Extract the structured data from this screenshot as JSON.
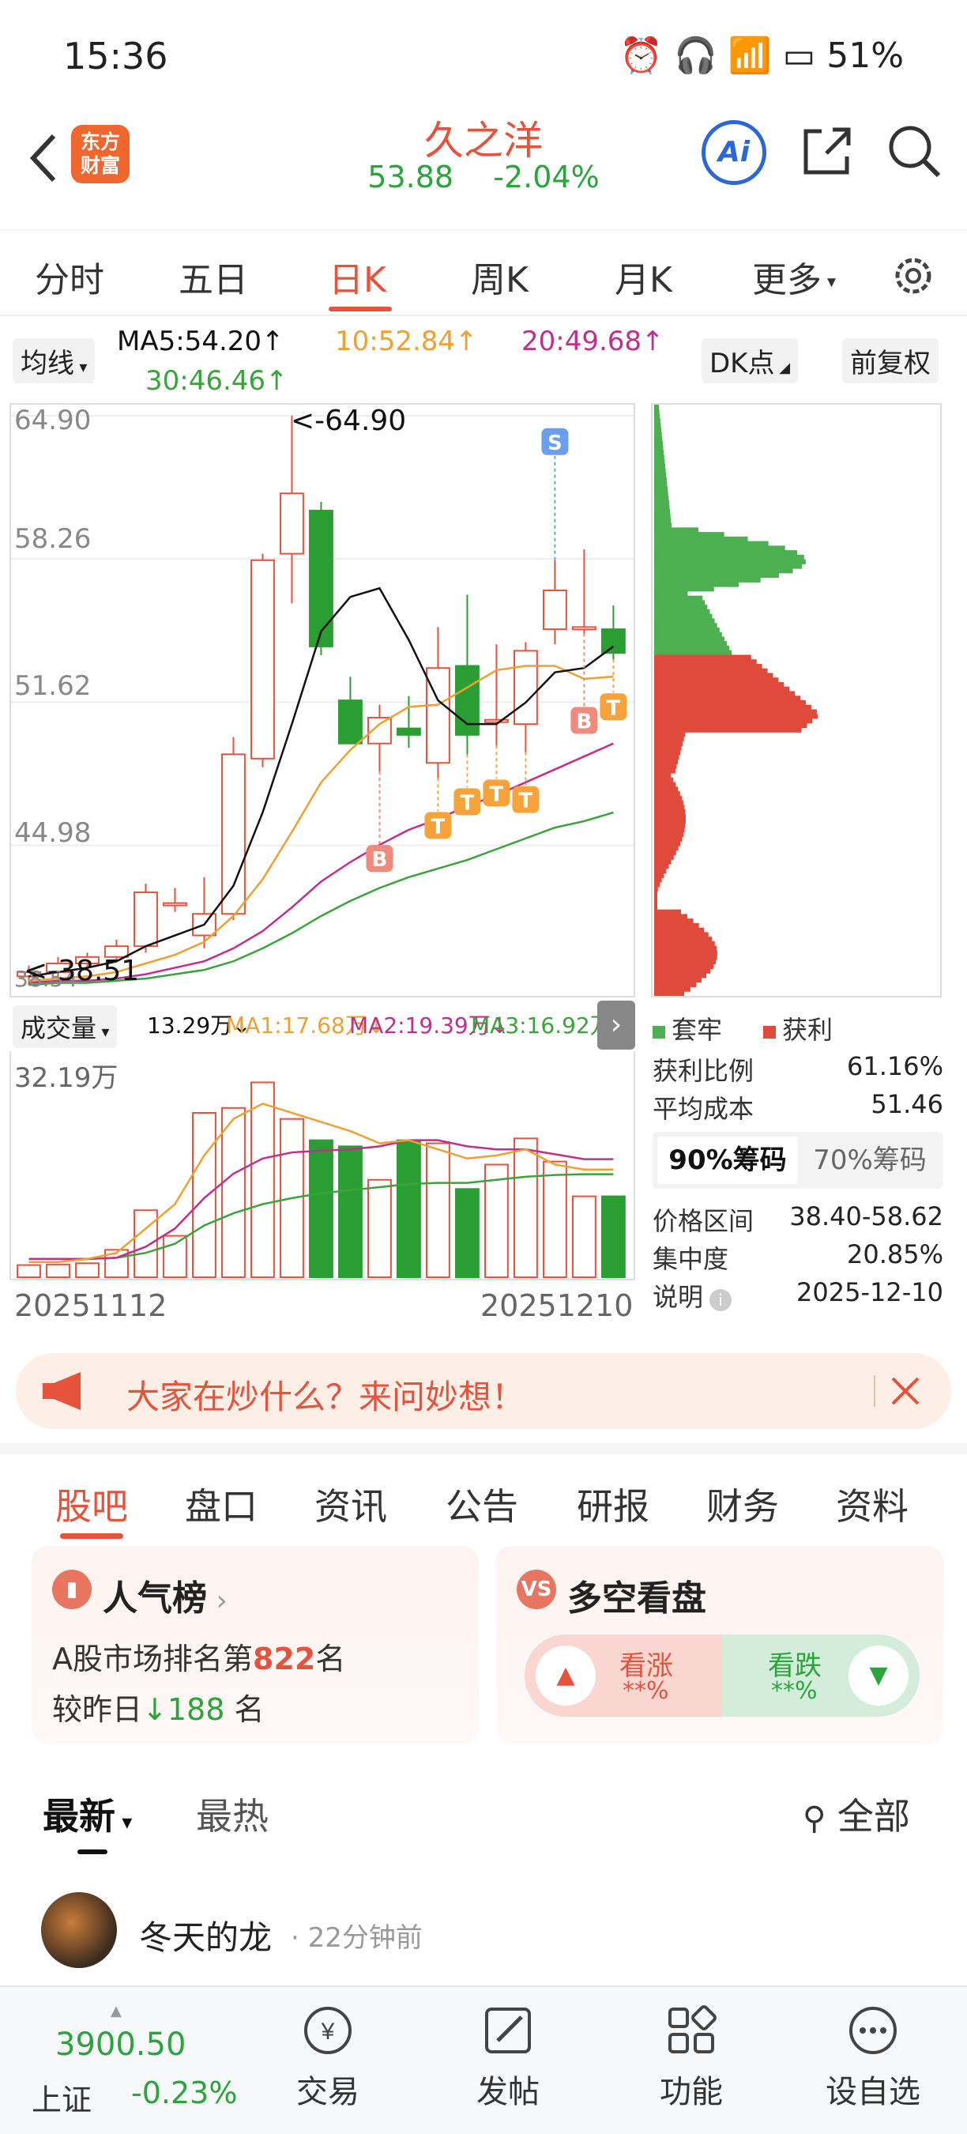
{
  "status_bar": {
    "time": "15:36",
    "battery": "51%"
  },
  "header": {
    "logo_text": "东方财富",
    "stock_name": "久之洋",
    "price": "53.88",
    "change": "-2.04%",
    "ai_label": "Ai"
  },
  "period_tabs": [
    "分时",
    "五日",
    "日K",
    "周K",
    "月K",
    "更多"
  ],
  "ma_bar": {
    "selector": "均线",
    "ma5": "MA5:54.20↑",
    "ma10": "10:52.84↑",
    "ma20": "20:49.68↑",
    "ma30": "30:46.46↑",
    "dk_button": "DK点",
    "fq_button": "前复权"
  },
  "kline_axis": {
    "y_ticks": [
      "64.90",
      "58.26",
      "51.62",
      "44.98"
    ],
    "bottom_tick": "38.54",
    "high_marker": "<-64.90",
    "low_marker": "<-38.51"
  },
  "volume_bar": {
    "selector": "成交量",
    "current": "13.29万↓",
    "ma1": "MA1:17.68万↓",
    "ma2": "MA2:19.39万↓",
    "ma3": "MA3:16.92万↑",
    "max_label": "32.19万",
    "date_start": "20251112",
    "date_end": "20251210"
  },
  "chip_panel": {
    "legend_trapped": "套牢",
    "legend_profit": "获利",
    "rows": [
      {
        "label": "获利比例",
        "value": "61.16%"
      },
      {
        "label": "平均成本",
        "value": "51.46"
      }
    ],
    "tab_90": "90%筹码",
    "tab_70": "70%筹码",
    "rows2": [
      {
        "label": "价格区间",
        "value": "38.40-58.62"
      },
      {
        "label": "集中度",
        "value": "20.85%"
      },
      {
        "label": "说明",
        "value": "2025-12-10"
      }
    ]
  },
  "banner": {
    "text": "大家在炒什么？来问妙想！"
  },
  "content_tabs": [
    "股吧",
    "盘口",
    "资讯",
    "公告",
    "研报",
    "财务",
    "资料"
  ],
  "popularity_card": {
    "title": "人气榜",
    "rank_prefix": "A股市场排名第",
    "rank": "822",
    "rank_suffix": "名",
    "change_prefix": "较昨日",
    "change_value": "188",
    "change_suffix": "名"
  },
  "sentiment_card": {
    "title": "多空看盘",
    "up_label": "看涨",
    "up_value": "**%",
    "down_label": "看跌",
    "down_value": "**%"
  },
  "feed": {
    "tab_latest": "最新",
    "tab_hot": "最热",
    "filter": "全部",
    "post_user": "冬天的龙",
    "post_time": "22分钟前"
  },
  "bottom_bar": {
    "index_value": "3900.50",
    "index_name": "上证",
    "index_change": "-0.23%",
    "items": [
      "交易",
      "发帖",
      "功能",
      "设自选"
    ]
  },
  "colors": {
    "up": "#e5533d",
    "down": "#2aa53b",
    "ma5": "#111111",
    "ma10": "#f0a030",
    "ma20": "#c0308a",
    "ma30": "#3aa33a"
  },
  "chart_data": {
    "type": "candlestick",
    "x_range": [
      "20251112",
      "20251210"
    ],
    "ylim": [
      38.51,
      64.9
    ],
    "candles": [
      {
        "o": 38.9,
        "h": 39.4,
        "l": 38.5,
        "c": 39.1
      },
      {
        "o": 39.1,
        "h": 39.8,
        "l": 38.9,
        "c": 39.5
      },
      {
        "o": 39.5,
        "h": 40.0,
        "l": 39.2,
        "c": 39.8
      },
      {
        "o": 39.8,
        "h": 40.6,
        "l": 39.6,
        "c": 40.3
      },
      {
        "o": 40.3,
        "h": 43.2,
        "l": 40.0,
        "c": 42.8
      },
      {
        "o": 42.3,
        "h": 43.0,
        "l": 41.9,
        "c": 42.3
      },
      {
        "o": 40.8,
        "h": 43.5,
        "l": 40.2,
        "c": 41.8
      },
      {
        "o": 41.8,
        "h": 50.0,
        "l": 41.5,
        "c": 49.2
      },
      {
        "o": 49.0,
        "h": 58.5,
        "l": 48.6,
        "c": 58.2
      },
      {
        "o": 58.5,
        "h": 64.9,
        "l": 56.2,
        "c": 61.3
      },
      {
        "o": 60.5,
        "h": 60.9,
        "l": 53.8,
        "c": 54.2
      },
      {
        "o": 51.7,
        "h": 52.8,
        "l": 49.7,
        "c": 49.7
      },
      {
        "o": 49.7,
        "h": 51.5,
        "l": 48.4,
        "c": 50.9
      },
      {
        "o": 50.4,
        "h": 51.9,
        "l": 49.5,
        "c": 50.1
      },
      {
        "o": 48.8,
        "h": 55.1,
        "l": 48.1,
        "c": 53.2
      },
      {
        "o": 53.3,
        "h": 56.6,
        "l": 49.2,
        "c": 50.1
      },
      {
        "o": 50.8,
        "h": 54.3,
        "l": 49.6,
        "c": 50.8
      },
      {
        "o": 50.6,
        "h": 54.4,
        "l": 49.3,
        "c": 54.0
      },
      {
        "o": 55.0,
        "h": 58.2,
        "l": 54.3,
        "c": 56.8
      },
      {
        "o": 55.0,
        "h": 58.7,
        "l": 54.8,
        "c": 55.1
      },
      {
        "o": 55.0,
        "h": 56.1,
        "l": 53.6,
        "c": 53.9
      }
    ],
    "ma5": [
      38.9,
      39.1,
      39.3,
      39.6,
      40.3,
      40.8,
      41.3,
      43.1,
      46.5,
      50.6,
      54.9,
      56.5,
      56.9,
      54.5,
      51.7,
      50.6,
      50.6,
      51.6,
      53.0,
      53.2,
      54.2
    ],
    "ma10": [
      38.7,
      38.8,
      38.9,
      39.1,
      39.5,
      39.9,
      40.5,
      41.7,
      43.4,
      45.6,
      47.9,
      49.4,
      50.6,
      51.4,
      51.5,
      52.3,
      53.1,
      53.3,
      53.3,
      52.7,
      52.8
    ],
    "ma20": [
      38.6,
      38.7,
      38.7,
      38.8,
      39.0,
      39.3,
      39.6,
      40.2,
      41.0,
      42.1,
      43.3,
      44.2,
      45.0,
      45.7,
      46.2,
      46.8,
      47.3,
      47.9,
      48.5,
      49.1,
      49.7
    ],
    "ma30": [
      38.5,
      38.6,
      38.6,
      38.7,
      38.8,
      39.0,
      39.2,
      39.6,
      40.2,
      40.9,
      41.7,
      42.4,
      43.0,
      43.5,
      43.9,
      44.3,
      44.8,
      45.3,
      45.8,
      46.1,
      46.5
    ],
    "signals": [
      {
        "index": 12,
        "type": "B"
      },
      {
        "index": 14,
        "type": "T"
      },
      {
        "index": 15,
        "type": "T"
      },
      {
        "index": 16,
        "type": "T"
      },
      {
        "index": 17,
        "type": "T"
      },
      {
        "index": 19,
        "type": "B"
      },
      {
        "index": 20,
        "type": "T"
      },
      {
        "index": 18,
        "type": "S"
      }
    ],
    "volume": {
      "max": 32.19,
      "unit": "万",
      "values": [
        2.0,
        2.1,
        2.3,
        4.5,
        11.0,
        6.8,
        27.0,
        27.8,
        32.0,
        26.0,
        22.5,
        21.5,
        16.0,
        22.5,
        22.0,
        14.5,
        18.5,
        22.8,
        19.0,
        13.29,
        13.29
      ],
      "ma1": [
        2.5,
        2.5,
        3.0,
        4.0,
        8.0,
        12.0,
        20.0,
        26.0,
        28.5,
        27.0,
        25.5,
        24.0,
        22.0,
        22.5,
        21.0,
        19.5,
        20.0,
        21.0,
        18.5,
        17.68,
        17.68
      ],
      "ma2": [
        3.0,
        3.0,
        3.0,
        3.2,
        5.0,
        8.0,
        13.0,
        17.0,
        19.5,
        20.5,
        20.8,
        21.0,
        21.5,
        22.5,
        22.5,
        21.5,
        21.0,
        21.0,
        20.2,
        19.39,
        19.39
      ],
      "ma3": [
        3.0,
        3.0,
        3.0,
        3.2,
        4.0,
        5.5,
        8.5,
        10.5,
        12.0,
        13.0,
        13.8,
        14.3,
        14.8,
        15.3,
        15.5,
        15.5,
        16.0,
        16.5,
        16.8,
        16.92,
        16.92
      ]
    }
  }
}
